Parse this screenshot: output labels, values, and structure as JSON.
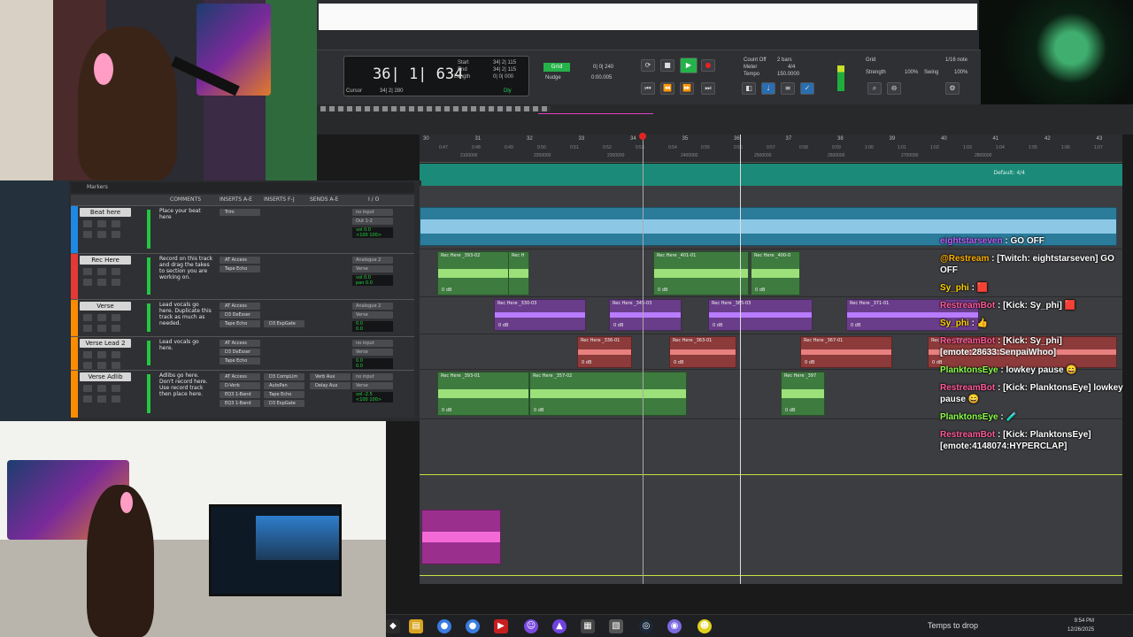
{
  "transport": {
    "main_counter": "36| 1| 634",
    "labels": {
      "start": "Start",
      "end": "End",
      "length": "Length",
      "cursor": "Cursor",
      "nudge": "Nudge",
      "grid": "Grid",
      "strength": "Strength",
      "swing": "Swing",
      "count_off": "Count Off",
      "meter": "Meter",
      "tempo": "Tempo"
    },
    "start_val": "34| 2| 115",
    "end_val": "34| 2| 115",
    "length_val": "0| 0| 000",
    "cursor_val": "34| 2| 280",
    "grid_val": "0| 0| 240",
    "nudge_val": "0:00.005",
    "bars": "2 bars",
    "meter_val": "4/4",
    "tempo_val": "150.0000",
    "grid_note": "1/16 note",
    "strength_val": "100%",
    "swing_val": "100%",
    "dly": "Dly"
  },
  "ruler": {
    "bars": [
      "30",
      "31",
      "32",
      "33",
      "34",
      "35",
      "36",
      "37",
      "38",
      "39",
      "40",
      "41",
      "42",
      "43"
    ],
    "times": [
      "0:47",
      "0:48",
      "0:49",
      "0:50",
      "0:51",
      "0:52",
      "0:53",
      "0:54",
      "0:55",
      "0:56",
      "0:57",
      "0:58",
      "0:59",
      "1:00",
      "1:01",
      "1:02",
      "1:03",
      "1:04",
      "1:05",
      "1:06",
      "1:07"
    ],
    "samples": [
      "2100000",
      "2200000",
      "2300000",
      "2400000",
      "2500000",
      "2600000",
      "2700000",
      "2800000"
    ],
    "tempo_label": "Default: 4/4"
  },
  "mixer": {
    "markers_label": "Markers",
    "columns": [
      "COMMENTS",
      "INSERTS A-E",
      "INSERTS F-J",
      "SENDS A-E",
      "I / O"
    ],
    "tracks": [
      {
        "name": "Beat here",
        "color": "#1e88e5",
        "comment": "Place your beat here",
        "inserts": [
          "Trim"
        ],
        "io_in": "no input",
        "io_out": "Out 1-2",
        "vol": "vol 0.0",
        "pan": "<100 100>"
      },
      {
        "name": "Rec Here",
        "color": "#e53935",
        "comment": "Record on this track and drag the takes to section you are working on.",
        "inserts": [
          "AT Access",
          "Tape Echo"
        ],
        "io_in": "Analogue 2",
        "io_out": "Verse",
        "vol": "vol 0.0",
        "pan": "pan 0.0"
      },
      {
        "name": "Verse",
        "color": "#fb8c00",
        "comment": "Lead vocals go here. Duplicate this track as much as needed.",
        "inserts": [
          "AT Access",
          "D3 DeEsser",
          "Tape Echo"
        ],
        "inserts2": [
          "D3 ExpGate"
        ],
        "io_in": "Analogue 2",
        "io_out": "Verse",
        "vol": "0.0",
        "pan": "0.0"
      },
      {
        "name": "Verse Lead 2",
        "color": "#fb8c00",
        "comment": "Lead vocals go here.",
        "inserts": [
          "AT Access",
          "D3 DeEsser",
          "Tape Echo"
        ],
        "io_in": "no input",
        "io_out": "Verse",
        "vol": "0.0",
        "pan": "0.0"
      },
      {
        "name": "Verse Adlib",
        "color": "#fb8c00",
        "comment": "Adlibs go here. Don't record here. Use record track then place here.",
        "inserts": [
          "AT Access",
          "D-Verb",
          "EQ3 1-Band",
          "EQ3 1-Band"
        ],
        "inserts2": [
          "D3 CompLim",
          "AutoPan",
          "Tape Echo",
          "D3 ExpGate"
        ],
        "sends": [
          "Verb Aux",
          "Delay Aux"
        ],
        "io_in": "no input",
        "io_out": "Verse",
        "vol": "vol -2.5",
        "pan": "<100 100>"
      }
    ]
  },
  "clips": {
    "rec_here": [
      {
        "name": "Rec Here _393-02",
        "gain": "0 dB"
      },
      {
        "name": "Rec H",
        "gain": ""
      },
      {
        "name": "Rec Here _401-01",
        "gain": "0 dB"
      },
      {
        "name": "Rec Here _400-0",
        "gain": "0 dB"
      }
    ],
    "verse": [
      {
        "name": "Rec Here _330-03",
        "gain": "0 dB"
      },
      {
        "name": "Rec Here _345-03",
        "gain": "0 dB"
      },
      {
        "name": "Rec Here _365-03",
        "gain": "0 dB"
      },
      {
        "name": "Rec Here _371-01",
        "gain": "0 dB"
      }
    ],
    "verse_lead": [
      {
        "name": "Rec Here _336-01",
        "gain": "0 dB"
      },
      {
        "name": "Rec Here _363-01",
        "gain": "0 dB"
      },
      {
        "name": "Rec Here _367-01",
        "gain": "0 dB"
      },
      {
        "name": "Rec Here _372-01",
        "gain": "0 dB"
      }
    ],
    "adlib": [
      {
        "name": "Rec Here _393-01",
        "gain": "0 dB"
      },
      {
        "name": "Rec Here _357-02",
        "gain": "0 dB"
      },
      {
        "name": "Rec Here _397",
        "gain": "0 dB"
      }
    ]
  },
  "chat": [
    {
      "user": "eightstarseven",
      "user_color": "#c060ff",
      "text": ": GO OFF"
    },
    {
      "user": "@Restream",
      "user_color": "#ffb000",
      "text": ": [Twitch: eightstarseven] GO OFF"
    },
    {
      "user": "Sy_phi",
      "user_color": "#ffd400",
      "text": ": 🟥"
    },
    {
      "user": "RestreamBot",
      "user_color": "#ff5a9a",
      "text": ": [Kick: Sy_phi] 🟥"
    },
    {
      "user": "Sy_phi",
      "user_color": "#ffd400",
      "text": ": 👍"
    },
    {
      "user": "RestreamBot",
      "user_color": "#ff5a9a",
      "text": ": [Kick: Sy_phi] [emote:28633:SenpaiWhoo]"
    },
    {
      "user": "PlanktonsEye",
      "user_color": "#8cff4a",
      "text": ": lowkey pause 😄"
    },
    {
      "user": "RestreamBot",
      "user_color": "#ff5a9a",
      "text": ": [Kick: PlanktonsEye] lowkey pause 😄"
    },
    {
      "user": "PlanktonsEye",
      "user_color": "#8cff4a",
      "text": ": 🧪"
    },
    {
      "user": "RestreamBot",
      "user_color": "#ff5a9a",
      "text": ": [Kick: PlanktonsEye] [emote:4148074:HYPERCLAP]"
    }
  ],
  "taskbar": {
    "drop_label": "Temps to drop",
    "time": "9:54 PM",
    "date": "12/26/2025"
  }
}
